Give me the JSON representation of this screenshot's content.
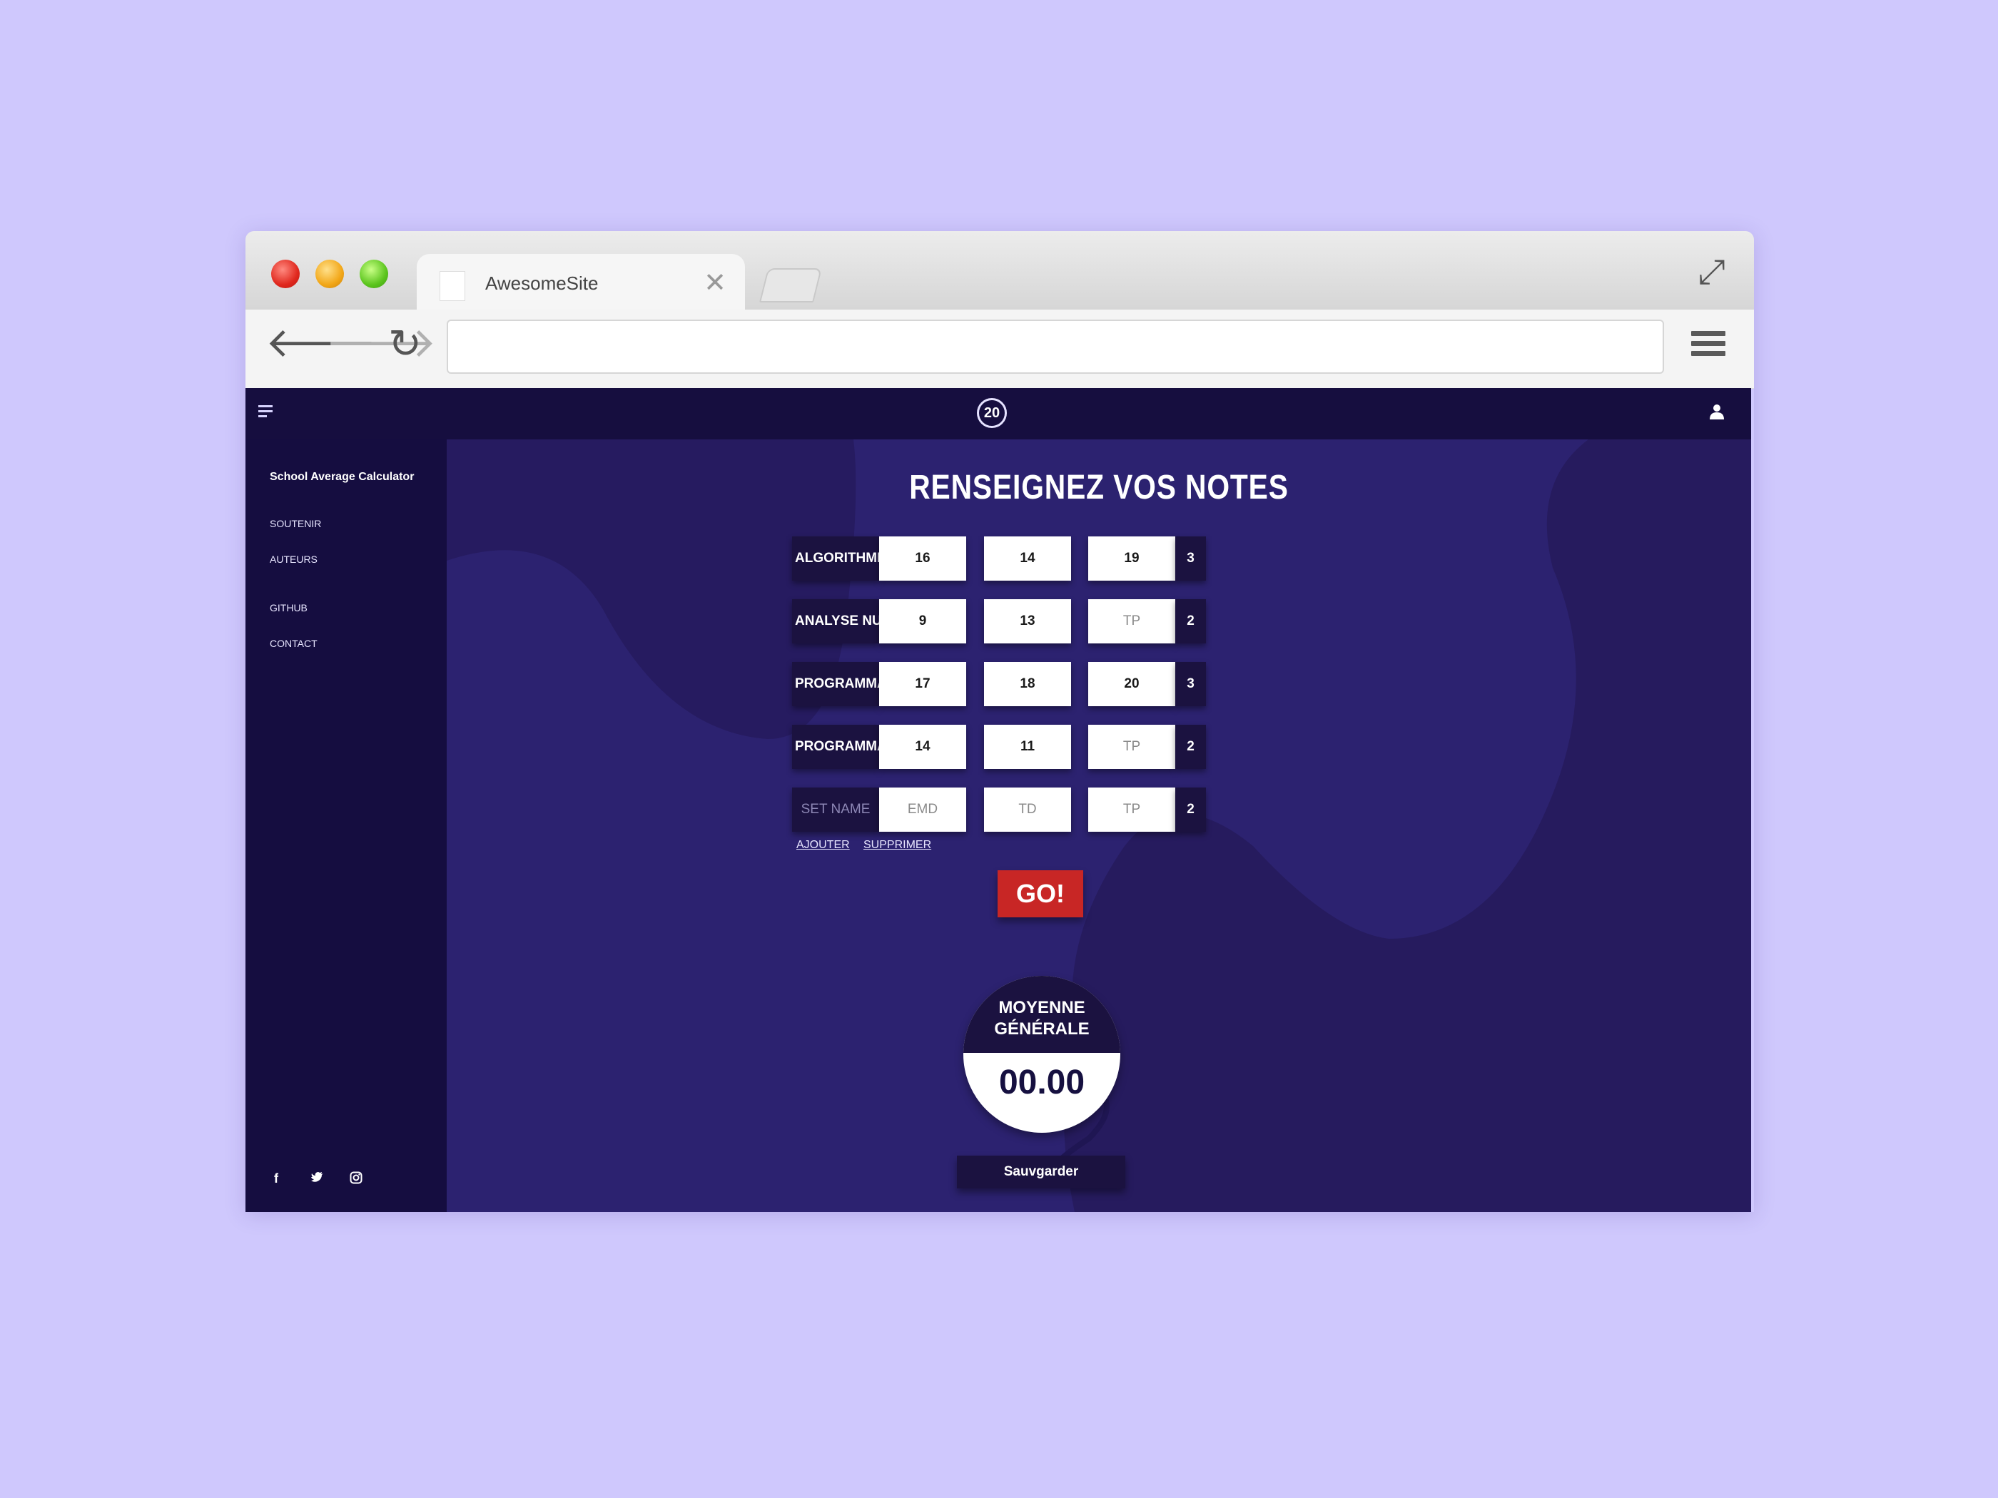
{
  "browser": {
    "tab_title": "AwesomeSite",
    "tab_close": "✕",
    "address": ""
  },
  "app": {
    "logo": "20",
    "brand": "School Average Calculator",
    "sidebar_links": [
      "SOUTENIR",
      "AUTEURS",
      "GITHUB",
      "CONTACT"
    ],
    "social": [
      "f",
      "t",
      "ig"
    ]
  },
  "form": {
    "title": "RENSEIGNEZ VOS NOTES",
    "rows": [
      {
        "name": "ALGORITHMES",
        "g1": "16",
        "g2": "14",
        "g3": "19",
        "coef": "3"
      },
      {
        "name": "ANALYSE NUMÉRIQUE",
        "g1": "9",
        "g2": "13",
        "g3": "",
        "coef": "2"
      },
      {
        "name": "PROGRAMMATION",
        "g1": "17",
        "g2": "18",
        "g3": "20",
        "coef": "3"
      },
      {
        "name": "PROGRAMMATION",
        "g1": "14",
        "g2": "11",
        "g3": "",
        "coef": "2"
      },
      {
        "name": "",
        "g1": "",
        "g2": "",
        "g3": "",
        "coef": "2"
      }
    ],
    "placeholders": {
      "name": "SET NAME",
      "g1": "EMD",
      "g2": "TD",
      "g3": "TP"
    },
    "add_label": "AJOUTER",
    "remove_label": "SUPPRIMER",
    "go_label": "GO!"
  },
  "result": {
    "label_line1": "MOYENNE",
    "label_line2": "GÉNÉRALE",
    "value": "00.00",
    "save_label": "Sauvgarder"
  },
  "colors": {
    "page_bg": "#cfc8fd",
    "app_dark": "#160e3f",
    "content_bg": "#2c2270",
    "go_red": "#c82625"
  }
}
